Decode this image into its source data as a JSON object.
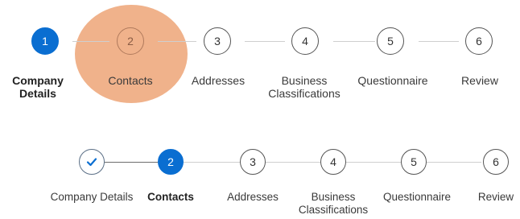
{
  "stepper_top": {
    "steps": [
      {
        "number": "1",
        "label": "Company Details",
        "state": "active"
      },
      {
        "number": "2",
        "label": "Contacts",
        "state": "highlighted"
      },
      {
        "number": "3",
        "label": "Addresses",
        "state": "pending"
      },
      {
        "number": "4",
        "label": "Business Classifications",
        "state": "pending"
      },
      {
        "number": "5",
        "label": "Questionnaire",
        "state": "pending"
      },
      {
        "number": "6",
        "label": "Review",
        "state": "pending"
      }
    ]
  },
  "stepper_bottom": {
    "steps": [
      {
        "number": "",
        "label": "Company Details",
        "state": "completed",
        "icon": "check-icon"
      },
      {
        "number": "2",
        "label": "Contacts",
        "state": "active"
      },
      {
        "number": "3",
        "label": "Addresses",
        "state": "pending"
      },
      {
        "number": "4",
        "label": "Business Classifications",
        "state": "pending"
      },
      {
        "number": "5",
        "label": "Questionnaire",
        "state": "pending"
      },
      {
        "number": "6",
        "label": "Review",
        "state": "pending"
      }
    ]
  },
  "colors": {
    "active": "#0a6ed1",
    "highlight": "#efae85",
    "line": "#cfcfcf"
  }
}
